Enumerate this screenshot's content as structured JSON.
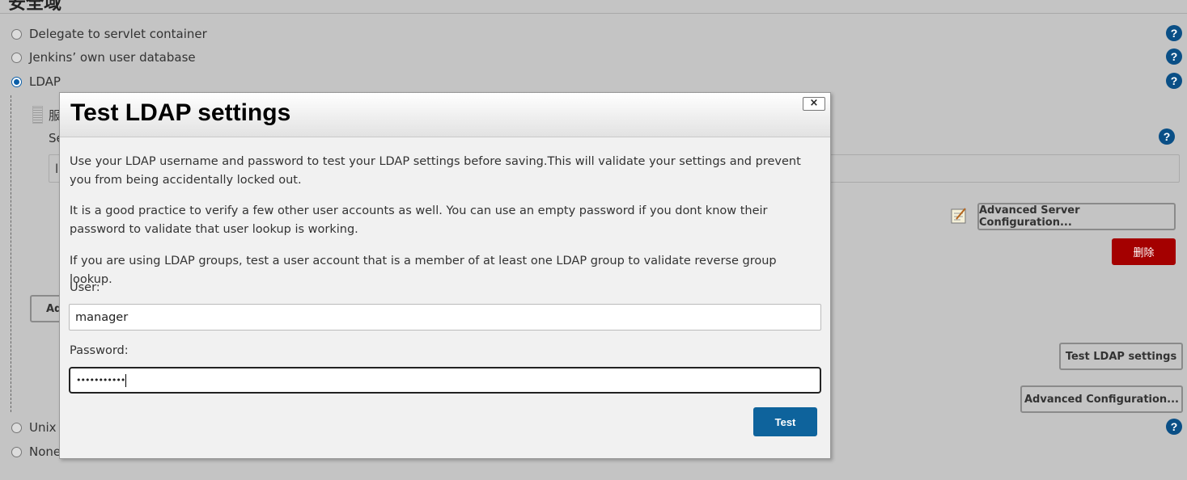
{
  "page": {
    "section_title": "安全域"
  },
  "realms": [
    {
      "label": "Delegate to servlet container",
      "checked": false
    },
    {
      "label": "Jenkins’ own user database",
      "checked": false
    },
    {
      "label": "LDAP",
      "checked": true
    },
    {
      "label": "Unix u",
      "checked": false
    },
    {
      "label": "None",
      "checked": false
    }
  ],
  "background": {
    "server_label_fragment": "服",
    "server_field_fragment": "Se",
    "input_fragment": "l",
    "add_button_fragment": "Ad",
    "advanced_server_config": "Advanced Server Configuration...",
    "delete_button": "删除",
    "test_ldap_button": "Test LDAP settings",
    "advanced_config": "Advanced Configuration..."
  },
  "modal": {
    "title": "Test LDAP settings",
    "close_label": "×",
    "paragraph1": "Use your LDAP username and password to test your LDAP settings before saving.This will validate your settings and prevent you from being accidentally locked out.",
    "paragraph2": "It is a good practice to verify a few other user accounts as well. You can use an empty password if you dont know their password to validate that user lookup is working.",
    "paragraph3": "If you are using LDAP groups, test a user account that is a member of at least one LDAP group to validate reverse group lookup.",
    "user_label": "User:",
    "user_value": "manager",
    "password_label": "Password:",
    "password_value": "•••••••••••",
    "test_button": "Test"
  },
  "colors": {
    "primary": "#0e639c",
    "danger": "#a40000",
    "help": "#0a4f86",
    "backdrop": "#c4c4c4"
  }
}
